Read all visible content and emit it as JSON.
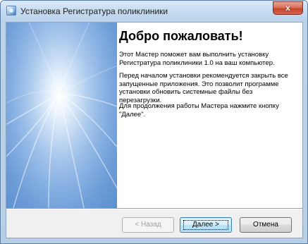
{
  "window": {
    "title": "Установка Регистратура поликлиники",
    "close_glyph": "x",
    "app_icon": "installer-icon"
  },
  "welcome": {
    "heading": "Добро пожаловать!",
    "paragraphs": [
      "Этот Мастер поможет вам выполнить установку Регистратура поликлиники 1.0 на ваш компьютер.",
      "Перед началом установки рекомендуется закрыть все запущенные приложения. Это позволит программе установки обновить системные файлы без перезагрузки.",
      "Для продолжения работы Мастера нажмите кнопку \"Далее\"."
    ]
  },
  "buttons": {
    "back": "< Назад",
    "next": "Далее >",
    "cancel": "Отмена"
  },
  "colors": {
    "banner_blue": "#6f9ed8",
    "titlebar": "#c5dbf0",
    "close_red": "#c7442c",
    "default_button_border": "#3c7fb1"
  }
}
